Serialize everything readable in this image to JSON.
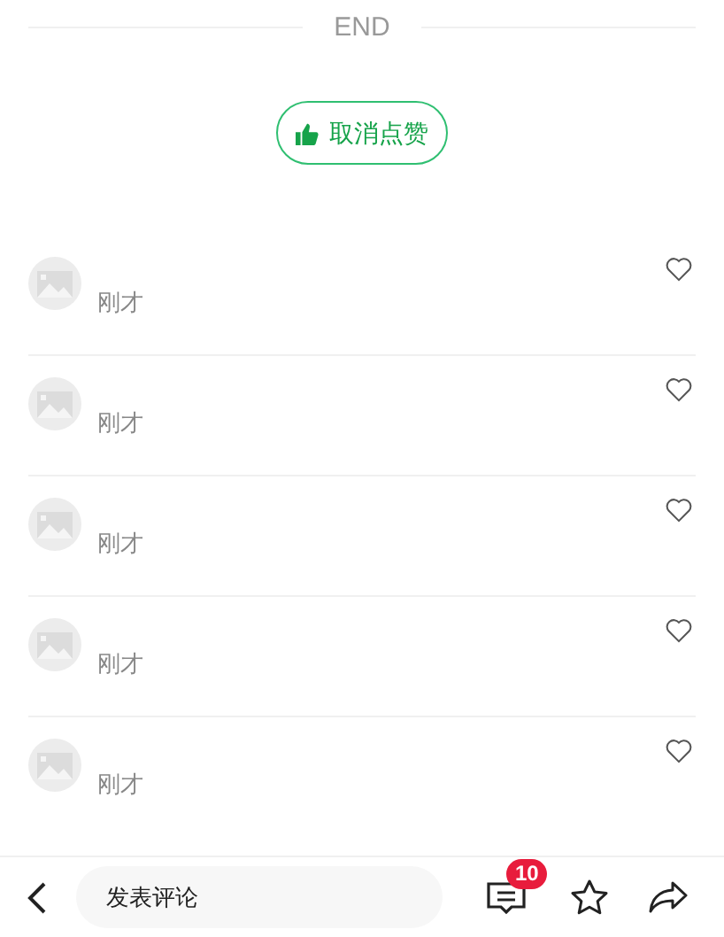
{
  "end_divider": {
    "label": "END"
  },
  "like_button": {
    "label": "取消点赞",
    "liked": true
  },
  "comments": [
    {
      "time": "刚才",
      "liked": false
    },
    {
      "time": "刚才",
      "liked": false
    },
    {
      "time": "刚才",
      "liked": false
    },
    {
      "time": "刚才",
      "liked": false
    },
    {
      "time": "刚才",
      "liked": false
    }
  ],
  "bottom_bar": {
    "comment_field": {
      "placeholder": "发表评论"
    },
    "comment_count": "10"
  }
}
